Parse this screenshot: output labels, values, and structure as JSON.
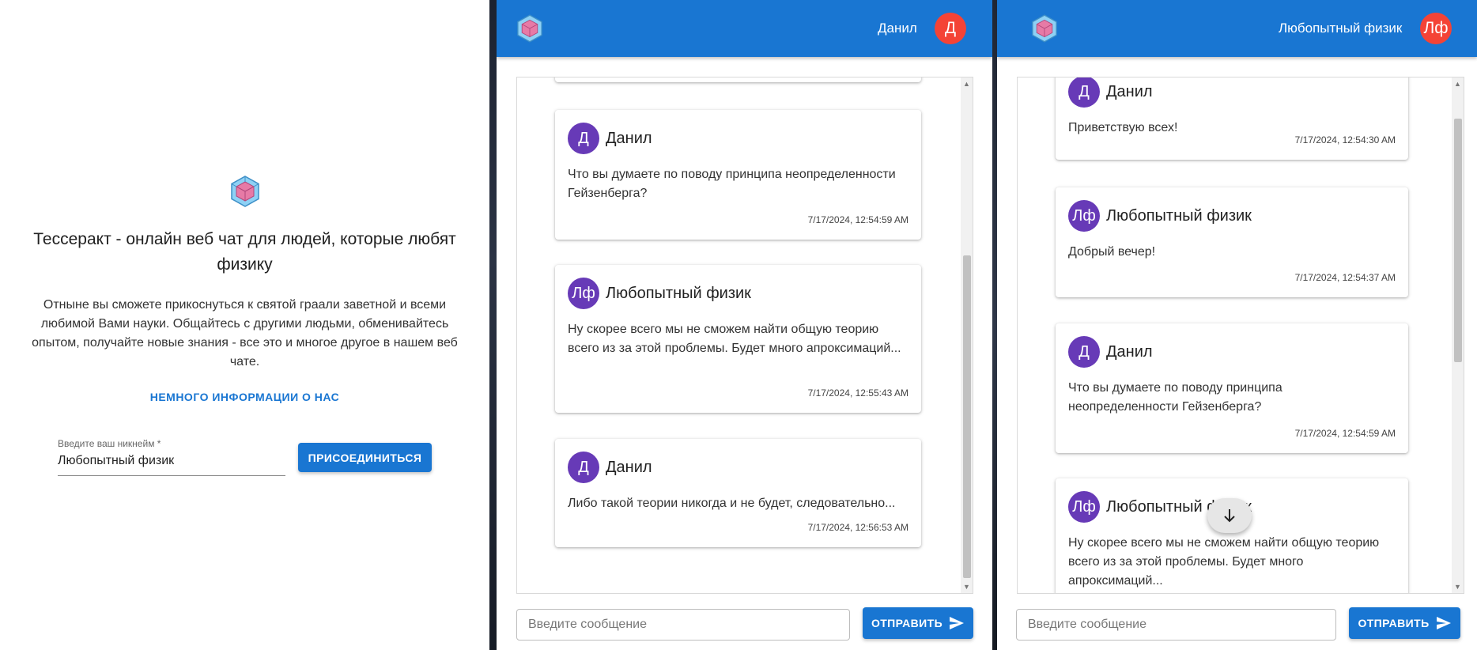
{
  "colors": {
    "primary": "#1976d2",
    "user_avatar": "#f44336",
    "message_avatar": "#673ab7"
  },
  "landing": {
    "logo_icon": "tesseract-cube-icon",
    "title": "Тессеракт - онлайн веб чат для людей, которые любят физику",
    "description": "Отныне вы сможете прикоснуться к святой граали заветной и всеми любимой Вами науки. Общайтесь с другими людьми, обменивайтесь опытом, получайте новые знания - все это и многое другое в нашем веб чате.",
    "about_link": "Немного информации о нас",
    "nickname_label": "Введите ваш никнейм *",
    "nickname_value": "Любопытный физик",
    "join_button": "Присоединиться"
  },
  "chat_left": {
    "user_name": "Данил",
    "user_initial": "Д",
    "messages": [
      {
        "initials": "Д",
        "author": "Данил",
        "text": "Что вы думаете по поводу принципа неопределенности Гейзенберга?",
        "time": "7/17/2024, 12:54:59 AM"
      },
      {
        "initials": "Лф",
        "author": "Любопытный физик",
        "text": "Ну скорее всего мы не сможем найти общую теорию всего из за этой проблемы. Будет много апроксимаций...",
        "time": "7/17/2024, 12:55:43 AM"
      },
      {
        "initials": "Д",
        "author": "Данил",
        "text": "Либо такой теории никогда и не будет, следовательно...",
        "time": "7/17/2024, 12:56:53 AM"
      }
    ],
    "input_placeholder": "Введите сообщение",
    "send_button": "Отправить"
  },
  "chat_right": {
    "user_name": "Любопытный физик",
    "user_initial": "Лф",
    "messages": [
      {
        "initials": "Д",
        "author": "Данил",
        "text": "Приветствую всех!",
        "time": "7/17/2024, 12:54:30 AM"
      },
      {
        "initials": "Лф",
        "author": "Любопытный физик",
        "text": "Добрый вечер!",
        "time": "7/17/2024, 12:54:37 AM"
      },
      {
        "initials": "Д",
        "author": "Данил",
        "text": "Что вы думаете по поводу принципа неопределенности Гейзенберга?",
        "time": "7/17/2024, 12:54:59 AM"
      },
      {
        "initials": "Лф",
        "author": "Любопытный физик",
        "text": "Ну скорее всего мы не сможем найти общую теорию всего из за этой проблемы. Будет много апроксимаций...",
        "time": ""
      }
    ],
    "input_placeholder": "Введите сообщение",
    "send_button": "Отправить",
    "scroll_down_icon": "arrow-down-icon"
  }
}
